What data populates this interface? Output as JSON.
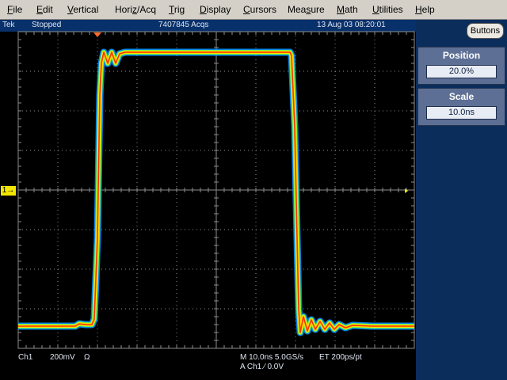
{
  "menu": [
    "File",
    "Edit",
    "Vertical",
    "Horiz/Acq",
    "Trig",
    "Display",
    "Cursors",
    "Measure",
    "Math",
    "Utilities",
    "Help"
  ],
  "menu_underline": [
    "F",
    "E",
    "V",
    "z",
    "T",
    "D",
    "C",
    "s",
    "M",
    "U",
    "H"
  ],
  "status": {
    "brand": "Tek",
    "run_state": "Stopped",
    "acqs": "7407845 Acqs",
    "datetime": "13 Aug 03 08:20:01"
  },
  "buttons_label": "Buttons",
  "position": {
    "title": "Position",
    "value": "20.0%"
  },
  "scale": {
    "title": "Scale",
    "value": "10.0ns"
  },
  "channel_marker": "1→",
  "readouts": {
    "channel": "Ch1",
    "volts_div": "200mV",
    "coupling": "Ω",
    "timebase": "M 10.0ns 5.0GS/s",
    "et": "ET 200ps/pt",
    "trigger": "A  Ch1  ∕  0.0V"
  },
  "colors": {
    "grid": "#8c8c8c",
    "trace_hot": "#ff3000",
    "trace_mid": "#ffe000",
    "trace_cool": "#00a0ff",
    "marker": "#f2e600"
  }
}
